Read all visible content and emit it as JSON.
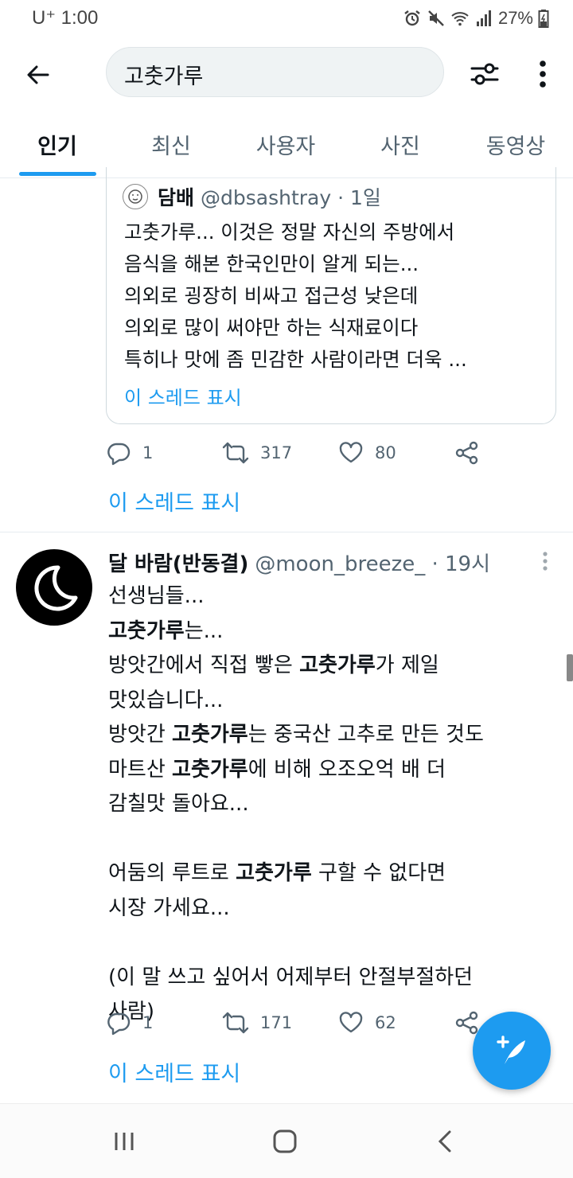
{
  "status_bar": {
    "carrier": "U⁺ 1:00",
    "battery": "27%"
  },
  "search": {
    "query": "고춧가루"
  },
  "tabs": [
    {
      "label": "인기",
      "active": true
    },
    {
      "label": "최신",
      "active": false
    },
    {
      "label": "사용자",
      "active": false
    },
    {
      "label": "사진",
      "active": false
    },
    {
      "label": "동영상",
      "active": false
    }
  ],
  "quoted_tweet": {
    "name": "담배",
    "handle_time": "@dbsashtray · 1일",
    "lines": [
      "고춧가루... 이것은 정말 자신의 주방에서",
      "음식을 해본 한국인만이 알게 되는...",
      "의외로 굉장히 비싸고 접근성 낮은데",
      "의외로 많이 써야만 하는 식재료이다",
      "특히나 맛에 좀 민감한 사람이라면 더욱 ..."
    ],
    "show_thread": "이 스레드 표시"
  },
  "tweet1_actions": {
    "replies": "1",
    "retweets": "317",
    "likes": "80"
  },
  "tweet1_show_thread": "이 스레드 표시",
  "tweet2": {
    "name": "달 바람(반동결)",
    "handle_time": "@moon_breeze_ · 19시",
    "lines": [
      {
        "pre": "선생님들...",
        "bold": "",
        "post": ""
      },
      {
        "pre": "",
        "bold": "고춧가루",
        "post": "는..."
      },
      {
        "pre": "방앗간에서 직접 빻은 ",
        "bold": "고춧가루",
        "post": "가 제일"
      },
      {
        "pre": "맛있습니다...",
        "bold": "",
        "post": ""
      },
      {
        "pre": "방앗간 ",
        "bold": "고춧가루",
        "post": "는 중국산 고추로 만든 것도"
      },
      {
        "pre": "마트산 ",
        "bold": "고춧가루",
        "post": "에 비해 오조오억 배 더"
      },
      {
        "pre": "감칠맛 돌아요...",
        "bold": "",
        "post": ""
      },
      {
        "pre": "",
        "bold": "",
        "post": ""
      },
      {
        "pre": "어둠의 루트로 ",
        "bold": "고춧가루",
        "post": " 구할 수 없다면"
      },
      {
        "pre": "시장 가세요...",
        "bold": "",
        "post": ""
      },
      {
        "pre": "",
        "bold": "",
        "post": ""
      },
      {
        "pre": "(이 말 쓰고 싶어서 어제부터 안절부절하던",
        "bold": "",
        "post": ""
      },
      {
        "pre": "사람)",
        "bold": "",
        "post": ""
      }
    ],
    "actions": {
      "replies": "1",
      "retweets": "171",
      "likes": "62"
    },
    "show_thread": "이 스레드 표시"
  },
  "colors": {
    "accent": "#1d9bf0",
    "text": "#0f1419",
    "secondary": "#536471"
  },
  "icons": [
    "back-arrow-icon",
    "filter-sliders-icon",
    "more-vertical-icon",
    "reply-icon",
    "retweet-icon",
    "like-icon",
    "share-icon",
    "compose-icon",
    "moon-icon"
  ]
}
